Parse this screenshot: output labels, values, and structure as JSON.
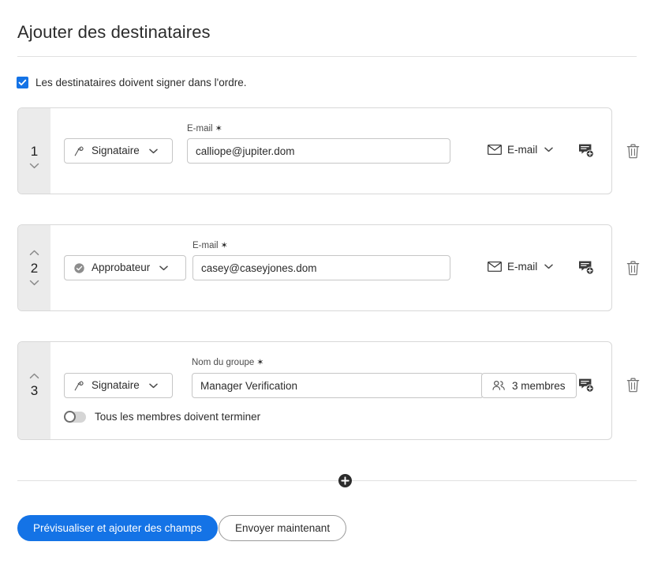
{
  "page": {
    "title": "Ajouter des destinataires"
  },
  "order_option": {
    "label": "Les destinataires doivent signer dans l'ordre.",
    "checked": true,
    "accent_color": "#1473e6"
  },
  "recipients": [
    {
      "number": "1",
      "role": {
        "label": "Signataire",
        "icon": "signature-pen-icon"
      },
      "field": {
        "label": "E-mail",
        "required_mark": "✶",
        "value": "calliope@jupiter.dom"
      },
      "delivery": {
        "label": "E-mail",
        "icon": "envelope-icon"
      },
      "add_message_icon": "add-message-icon",
      "delete_icon": "trash-icon",
      "move_up": false,
      "move_down": true
    },
    {
      "number": "2",
      "role": {
        "label": "Approbateur",
        "icon": "approve-check-icon"
      },
      "field": {
        "label": "E-mail",
        "required_mark": "✶",
        "value": "casey@caseyjones.dom"
      },
      "delivery": {
        "label": "E-mail",
        "icon": "envelope-icon"
      },
      "add_message_icon": "add-message-icon",
      "delete_icon": "trash-icon",
      "move_up": true,
      "move_down": true
    },
    {
      "number": "3",
      "role": {
        "label": "Signataire",
        "icon": "signature-pen-icon"
      },
      "field": {
        "label": "Nom du groupe",
        "required_mark": "✶",
        "value": "Manager Verification"
      },
      "members_button": {
        "label": "3 membres",
        "icon": "members-icon"
      },
      "toggle": {
        "label": "Tous les membres doivent terminer",
        "on": false
      },
      "add_message_icon": "add-message-icon",
      "delete_icon": "trash-icon",
      "move_up": true,
      "move_down": false
    }
  ],
  "add_recipient": {
    "icon": "plus-circle-icon"
  },
  "footer": {
    "primary_label": "Prévisualiser et ajouter des champs",
    "secondary_label": "Envoyer maintenant",
    "primary_color": "#1473e6"
  }
}
